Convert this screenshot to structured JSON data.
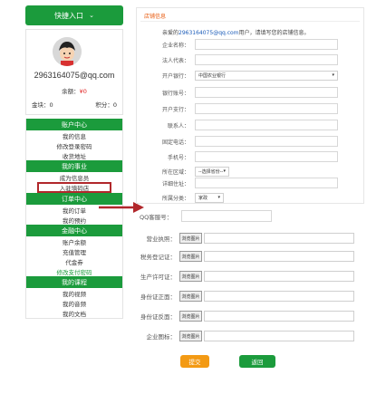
{
  "sidebar": {
    "quick_entry": "快捷入口",
    "user": {
      "username": "2963164075@qq.com",
      "balance_label": "余额：",
      "balance_value": "¥0",
      "gold_label": "金块：",
      "gold_value": "0",
      "points_label": "积分：",
      "points_value": "0"
    },
    "groups": [
      {
        "title": "账户中心",
        "items": [
          "我的信息",
          "修改登录密码",
          "收货地址"
        ]
      },
      {
        "title": "我的事业",
        "items": [
          "成为信息员",
          "入驻填码店"
        ]
      },
      {
        "title": "订单中心",
        "items": [
          "我的订单",
          "我的预约"
        ]
      },
      {
        "title": "金融中心",
        "items": [
          "账户余额",
          "充值管理",
          "代金券",
          "修改支付密码"
        ]
      },
      {
        "title": "我的课程",
        "items": [
          "我的视频",
          "我的音频",
          "我的文档"
        ]
      }
    ]
  },
  "form": {
    "section_title": "店铺信息",
    "greeting_prefix": "亲爱的",
    "greeting_email": "2963164075@qq.com",
    "greeting_suffix": "用户，请填写您的店铺信息。",
    "fields": {
      "company_name": "企业名称：",
      "legal_rep": "法人代表：",
      "bank": "开户银行：",
      "bank_selected": "中国农业银行",
      "bank_account": "银行账号：",
      "branch": "开户支行：",
      "contact": "联系人：",
      "phone": "固定电话：",
      "mobile": "手机号：",
      "region": "所在区域：",
      "region_selected": "--选择省份--",
      "address": "详细住址：",
      "category": "所属分类：",
      "category_selected": "家政"
    },
    "qq_label": "QQ客服号：",
    "uploads": {
      "button_label": "浏览图片",
      "rows": [
        "营业执照：",
        "税务登记证：",
        "生产许可证：",
        "身份证正面：",
        "身份证反面：",
        "企业图标："
      ]
    },
    "submit_label": "提交",
    "back_label": "返回"
  },
  "colors": {
    "brand_green": "#1b9b3c",
    "accent_orange": "#f39a14",
    "highlight_red": "#b1272b"
  }
}
